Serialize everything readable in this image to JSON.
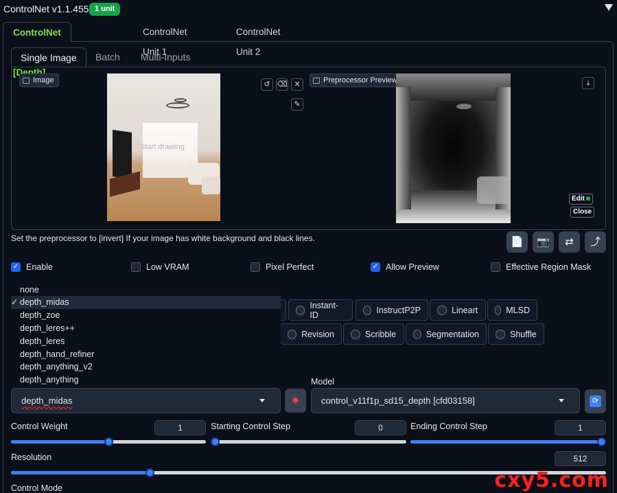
{
  "header": {
    "title": "ControlNet v1.1.455",
    "badge": "1 unit"
  },
  "unit_tabs": [
    "ControlNet Unit 0 [Depth]",
    "ControlNet Unit 1",
    "ControlNet Unit 2"
  ],
  "input_tabs": [
    "Single Image",
    "Batch",
    "Multi-Inputs"
  ],
  "image_panel": {
    "label": "Image",
    "overlay_text": "Start drawing"
  },
  "preview_panel": {
    "label": "Preprocessor Preview",
    "edit_label": "Edit",
    "close_label": "Close"
  },
  "hint": "Set the preprocessor to [invert] If your image has white background and black lines.",
  "checkboxes": [
    {
      "label": "Enable",
      "checked": true
    },
    {
      "label": "Low VRAM",
      "checked": false
    },
    {
      "label": "Pixel Perfect",
      "checked": false
    },
    {
      "label": "Allow Preview",
      "checked": true
    },
    {
      "label": "Effective Region Mask",
      "checked": false
    }
  ],
  "control_types_row1": [
    "Instant-ID",
    "InstructP2P",
    "Lineart",
    "MLSD"
  ],
  "control_types_row2": [
    "Revision",
    "Scribble",
    "Segmentation",
    "Shuffle"
  ],
  "preprocessor_options": [
    "none",
    "depth_midas",
    "depth_zoe",
    "depth_leres++",
    "depth_leres",
    "depth_hand_refiner",
    "depth_anything_v2",
    "depth_anything"
  ],
  "preprocessor_selected": "depth_midas",
  "model": {
    "label": "Model",
    "value": "control_v11f1p_sd15_depth [cfd03158]"
  },
  "sliders": {
    "control_weight": {
      "label": "Control Weight",
      "value": "1",
      "fraction": 0.5
    },
    "starting_step": {
      "label": "Starting Control Step",
      "value": "0",
      "fraction": 0.0
    },
    "ending_step": {
      "label": "Ending Control Step",
      "value": "1",
      "fraction": 1.0
    },
    "resolution": {
      "label": "Resolution",
      "value": "512",
      "fraction": 0.23
    }
  },
  "control_mode_label": "Control Mode",
  "watermark": "cxy5.com",
  "colors": {
    "accent_green": "#7ee14f",
    "badge_green": "#16a34a",
    "slider_blue": "#3b82f6",
    "watermark_red": "#ff2020"
  }
}
